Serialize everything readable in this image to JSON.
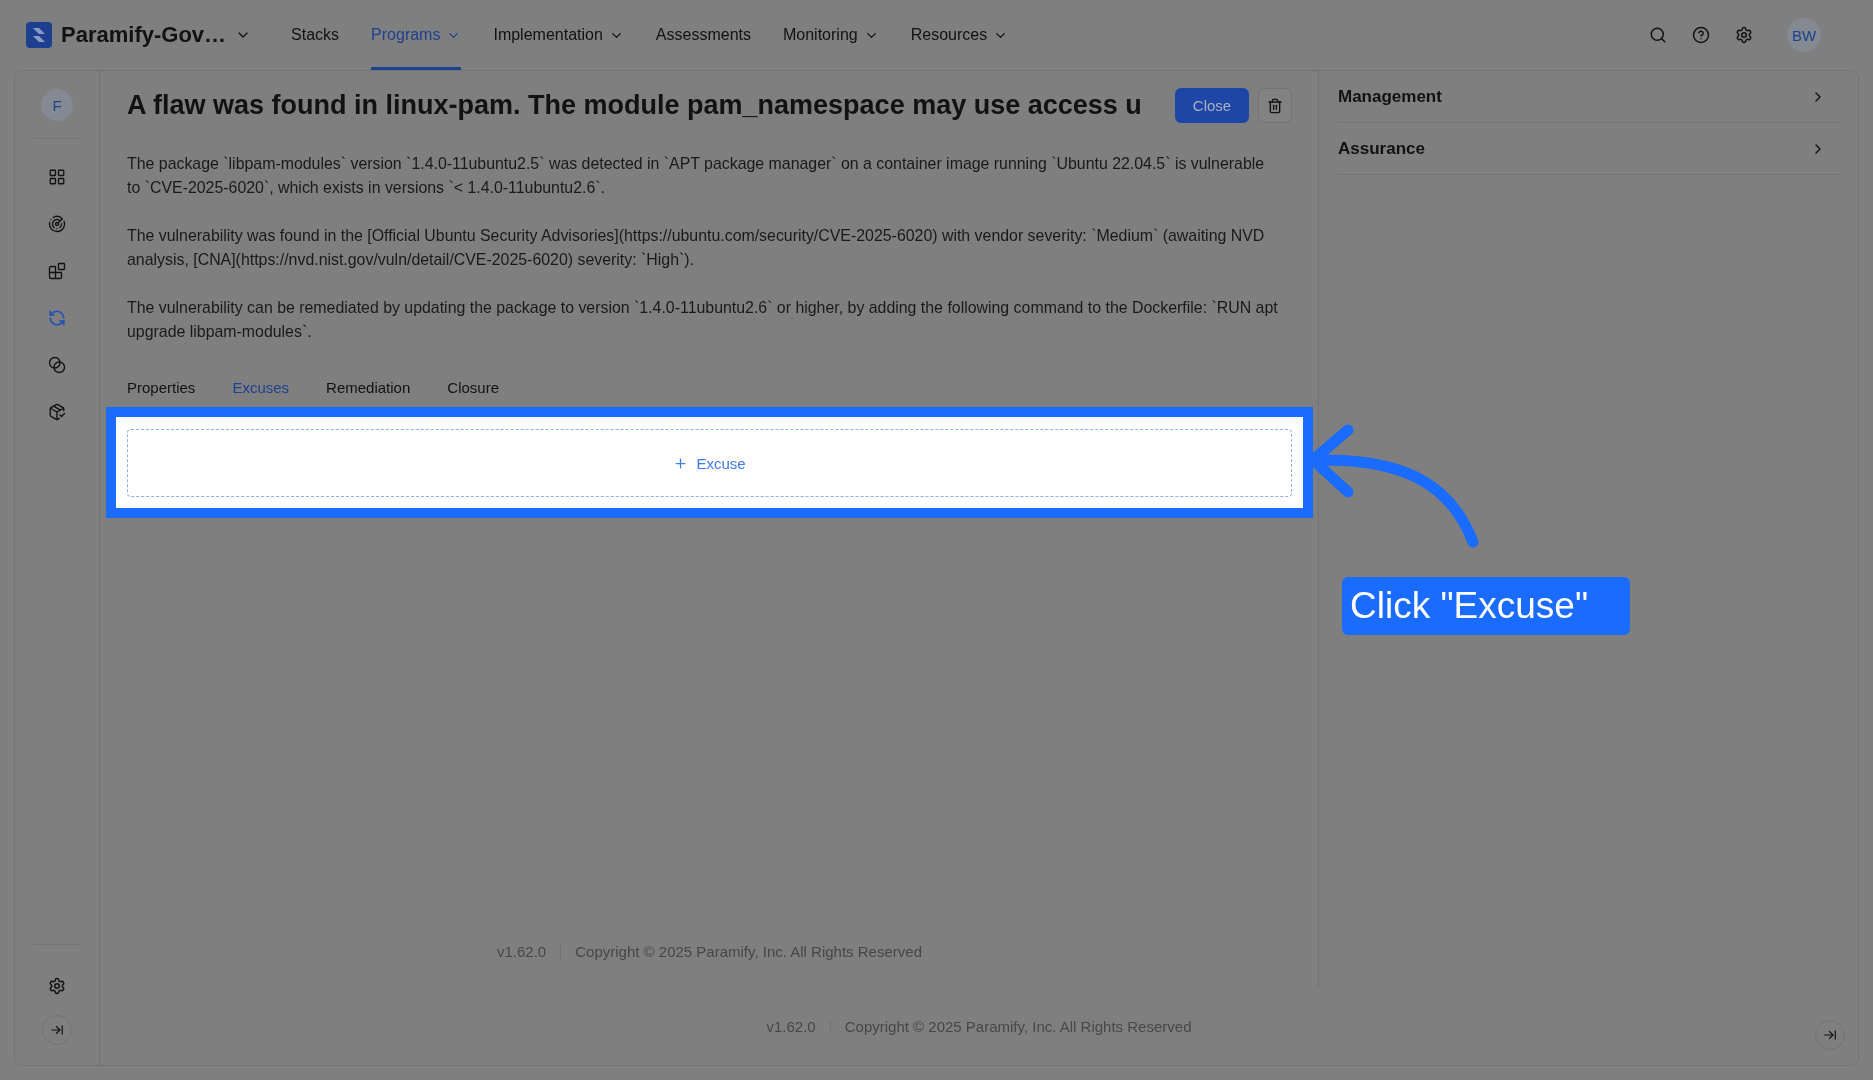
{
  "top_bar": {
    "workspace": "Paramify-Gov…",
    "nav": [
      {
        "label": "Stacks",
        "selected": false,
        "dropdown": false
      },
      {
        "label": "Programs",
        "selected": true,
        "dropdown": true
      },
      {
        "label": "Implementation",
        "selected": false,
        "dropdown": true
      },
      {
        "label": "Assessments",
        "selected": false,
        "dropdown": false
      },
      {
        "label": "Monitoring",
        "selected": false,
        "dropdown": true
      },
      {
        "label": "Resources",
        "selected": false,
        "dropdown": true
      }
    ],
    "user_initials": "BW"
  },
  "sidebar": {
    "workspace_initial": "F",
    "items": [
      {
        "selected": false
      },
      {
        "selected": false
      },
      {
        "selected": false
      },
      {
        "selected": true
      },
      {
        "selected": false
      },
      {
        "selected": false
      }
    ]
  },
  "finding": {
    "title": "A flaw was found in linux-pam. The module pam_namespace may use access u",
    "close_button": "Close",
    "paragraphs": [
      "The package `libpam-modules` version `1.4.0-11ubuntu2.5` was detected in `APT package manager` on a container image running `Ubuntu 22.04.5` is vulnerable to `CVE-2025-6020`, which exists in versions `< 1.4.0-11ubuntu2.6`.",
      "The vulnerability was found in the [Official Ubuntu Security Advisories](https://ubuntu.com/security/CVE-2025-6020) with vendor severity: `Medium` (awaiting NVD analysis, [CNA](https://nvd.nist.gov/vuln/detail/CVE-2025-6020) severity: `High`).",
      "The vulnerability can be remediated by updating the package to version `1.4.0-11ubuntu2.6` or higher, by adding the following command to the Dockerfile: `RUN apt upgrade libpam-modules`."
    ],
    "tabs": [
      {
        "label": "Properties",
        "selected": false
      },
      {
        "label": "Excuses",
        "selected": true
      },
      {
        "label": "Remediation",
        "selected": false
      },
      {
        "label": "Closure",
        "selected": false
      }
    ],
    "add_excuse_button": "Excuse",
    "footer": {
      "version": "v1.62.0",
      "copyright": "Copyright © 2025 Paramify, Inc. All Rights Reserved"
    }
  },
  "right_panel": {
    "sections": [
      {
        "title": "Management",
        "expanded": false
      },
      {
        "title": "Assurance",
        "expanded": false
      }
    ]
  },
  "page_footer": {
    "version": "v1.62.0",
    "copyright": "Copyright © 2025 Paramify, Inc. All Rights Reserved"
  },
  "annotation": {
    "callout": "Click \"Excuse\""
  }
}
